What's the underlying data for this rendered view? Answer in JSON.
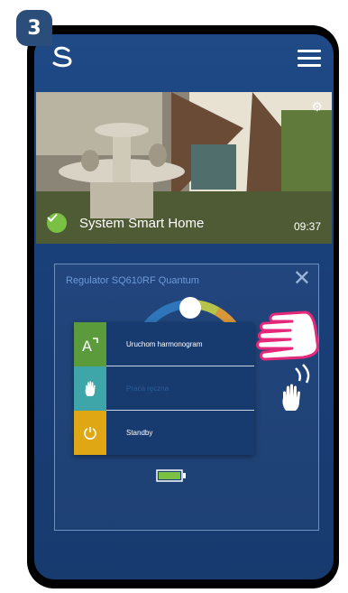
{
  "step": "3",
  "hero": {
    "title": "System Smart Home",
    "time": "09:37"
  },
  "panel": {
    "title": "Regulator SQ610RF Quantum",
    "close_glyph": "✕"
  },
  "mode_menu": [
    {
      "label": "Uruchom harmonogram",
      "icon": "auto-schedule-icon",
      "color": "#5c9b3b"
    },
    {
      "label": "Praca ręczna",
      "icon": "hand-icon",
      "color": "#3ea5a8"
    },
    {
      "label": "Standby",
      "icon": "power-icon",
      "color": "#e0a715"
    }
  ],
  "colors": {
    "screen": "#1a3f78",
    "accent_green": "#7ac143"
  }
}
